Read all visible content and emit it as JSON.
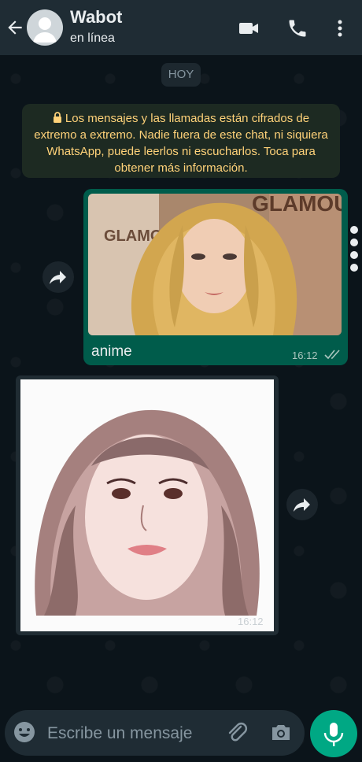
{
  "header": {
    "contact_name": "Wabot",
    "status": "en línea",
    "icons": [
      "back-arrow-icon",
      "avatar",
      "video-call-icon",
      "voice-call-icon",
      "more-options-icon"
    ]
  },
  "chat": {
    "day_label": "HOY",
    "encryption_notice": "Los mensajes y las llamadas están cifrados de extremo a extremo. Nadie fuera de este chat, ni siquiera WhatsApp, puede leerlos ni escucharlos. Toca para obtener más información.",
    "messages": [
      {
        "direction": "outgoing",
        "caption": "anime",
        "time": "16:12",
        "status_icon": "double-check-icon",
        "photo_text": "GLAMOUR"
      },
      {
        "direction": "incoming",
        "time": "16:12"
      }
    ]
  },
  "input": {
    "placeholder": "Escribe un mensaje",
    "value": "",
    "icons": [
      "emoji-icon",
      "attach-icon",
      "camera-icon",
      "microphone-icon"
    ]
  },
  "colors": {
    "header_bg": "#1f2c34",
    "outgoing_bubble": "#005c4b",
    "incoming_bubble": "#202c33",
    "accent": "#00a884",
    "notice_text": "#ffd279"
  }
}
